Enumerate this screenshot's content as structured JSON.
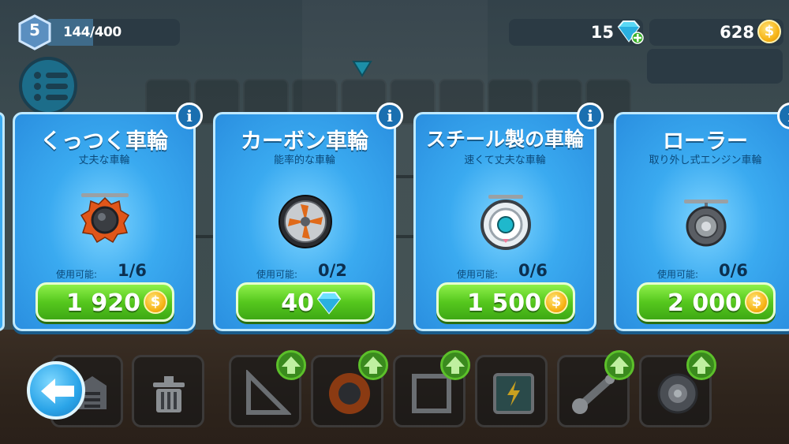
{
  "hud": {
    "level": "5",
    "xp_text": "144/400",
    "xp_progress": 0.36,
    "gems": "15",
    "coins": "628"
  },
  "cards": [
    {
      "title": "くっつく車輪",
      "subtitle": "丈夫な車輪",
      "avail_label": "使用可能:",
      "avail_value": "1/6",
      "price": "1 920",
      "currency": "coin-icon",
      "wheel": "sticky-wheel-icon"
    },
    {
      "title": "カーボン車輪",
      "subtitle": "能率的な車輪",
      "avail_label": "使用可能:",
      "avail_value": "0/2",
      "price": "40",
      "currency": "diamond-icon",
      "wheel": "carbon-wheel-icon"
    },
    {
      "title": "スチール製の車輪",
      "subtitle": "速くて丈夫な車輪",
      "avail_label": "使用可能:",
      "avail_value": "0/6",
      "price": "1 500",
      "currency": "coin-icon",
      "wheel": "steel-wheel-icon"
    },
    {
      "title": "ローラー",
      "subtitle": "取り外し式エンジン車輪",
      "avail_label": "使用可能:",
      "avail_value": "0/6",
      "price": "2 000",
      "currency": "coin-icon",
      "wheel": "roller-wheel-icon"
    }
  ],
  "coin_symbol": "$",
  "info_symbol": "i",
  "colors": {
    "card_blue": "#3aaaf0",
    "buy_green": "#56c81e",
    "coin_gold": "#f7b518",
    "hud_dark": "#2b3a44"
  }
}
